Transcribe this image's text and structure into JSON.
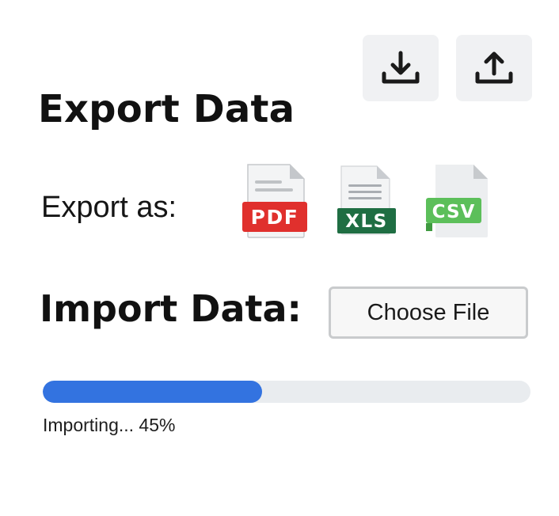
{
  "toolbar": {
    "download_icon": "download-icon",
    "upload_icon": "upload-icon"
  },
  "export": {
    "title": "Export Data",
    "label": "Export as:",
    "formats": [
      {
        "label": "PDF",
        "badge_color": "#e0302d"
      },
      {
        "label": "XLS",
        "badge_color": "#1f6e43"
      },
      {
        "label": "CSV",
        "badge_color": "#5cbf5a"
      }
    ]
  },
  "import": {
    "title": "Import Data:",
    "choose_file_label": "Choose File"
  },
  "progress": {
    "fraction": 0.45,
    "text": "Importing... 45%",
    "fill_color": "#3373e0"
  }
}
